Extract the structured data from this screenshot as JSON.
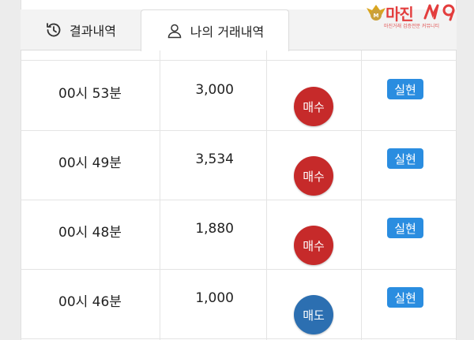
{
  "tabs": {
    "history_label": "결과내역",
    "mytrades_label": "나의 거래내역",
    "history_icon": "history-icon",
    "mytrades_icon": "user-icon"
  },
  "logo": {
    "text": "마진",
    "subtext": "마진거래 검증전문 커뮤니티"
  },
  "colors": {
    "buy": "#c62a2a",
    "sell": "#2c6fb1",
    "badge": "#2a8de0",
    "logo": "#e33d3d"
  },
  "trades": {
    "rows": [
      {
        "time": "00시 53분",
        "amount": "3,000",
        "action": "매수",
        "action_type": "buy",
        "status": "실현"
      },
      {
        "time": "00시 49분",
        "amount": "3,534",
        "action": "매수",
        "action_type": "buy",
        "status": "실현"
      },
      {
        "time": "00시 48분",
        "amount": "1,880",
        "action": "매수",
        "action_type": "buy",
        "status": "실현"
      },
      {
        "time": "00시 46분",
        "amount": "1,000",
        "action": "매도",
        "action_type": "sell",
        "status": "실현"
      }
    ]
  }
}
